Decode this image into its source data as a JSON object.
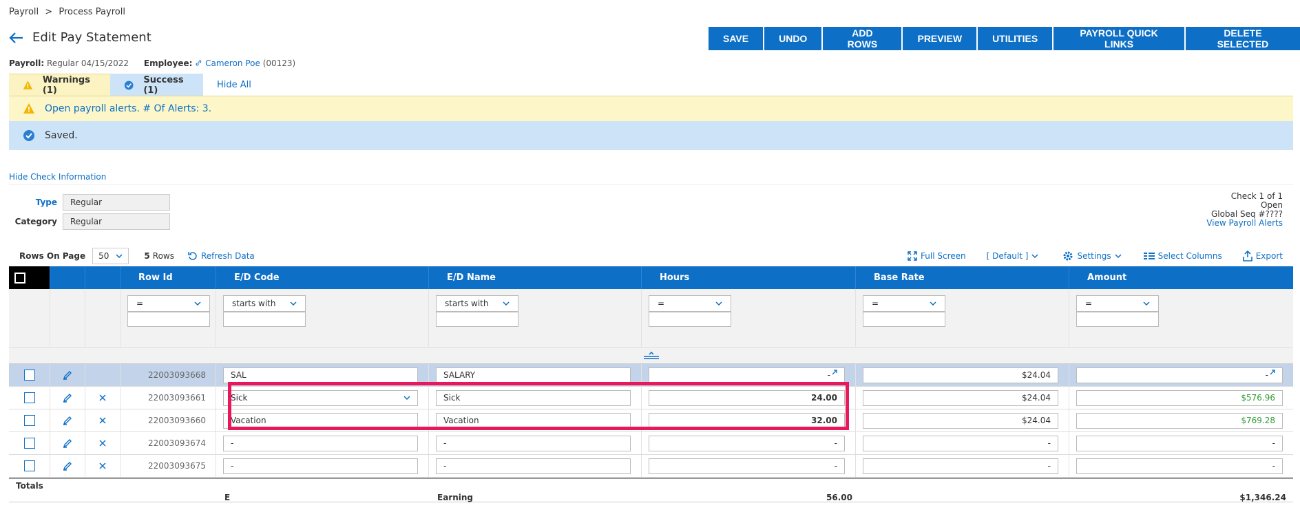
{
  "breadcrumb": {
    "root": "Payroll",
    "separator": ">",
    "current": "Process Payroll"
  },
  "page": {
    "title": "Edit Pay Statement"
  },
  "toolbar": [
    "SAVE",
    "UNDO",
    "ADD ROWS",
    "PREVIEW",
    "UTILITIES",
    "PAYROLL QUICK LINKS",
    "DELETE SELECTED"
  ],
  "meta": {
    "payroll_label": "Payroll:",
    "payroll_value": "Regular 04/15/2022",
    "employee_label": "Employee:",
    "employee_name": "Cameron Poe",
    "employee_id": "(00123)"
  },
  "tabs": {
    "warnings": "Warnings (1)",
    "success": "Success (1)",
    "hide_all": "Hide All"
  },
  "alerts": {
    "warning": "Open payroll alerts. # Of Alerts: 3.",
    "success": "Saved."
  },
  "check": {
    "hide_link": "Hide Check Information",
    "type_label": "Type",
    "type_value": "Regular",
    "category_label": "Category",
    "category_value": "Regular",
    "check_num": "Check 1 of 1",
    "status": "Open",
    "global_seq": "Global Seq #????",
    "view_alerts": "View Payroll Alerts"
  },
  "grid_tools": {
    "rows_on_page_label": "Rows On Page",
    "rows_on_page": "50",
    "row_count": "5",
    "rows_label": "Rows",
    "refresh": "Refresh Data",
    "full_screen": "Full Screen",
    "view": "[ Default ]",
    "settings": "Settings",
    "select_columns": "Select Columns",
    "export": "Export"
  },
  "columns": [
    "Row Id",
    "E/D Code",
    "E/D Name",
    "Hours",
    "Base Rate",
    "Amount"
  ],
  "filters": [
    "=",
    "starts with",
    "starts with",
    "=",
    "=",
    "="
  ],
  "rows": [
    {
      "id": "22003093668",
      "code": "SAL",
      "name": "SALARY",
      "hours": "-",
      "rate": "$24.04",
      "amount": "-"
    },
    {
      "id": "22003093661",
      "code": "Sick",
      "name": "Sick",
      "hours": "24.00",
      "rate": "$24.04",
      "amount": "$576.96"
    },
    {
      "id": "22003093660",
      "code": "Vacation",
      "name": "Vacation",
      "hours": "32.00",
      "rate": "$24.04",
      "amount": "$769.28"
    },
    {
      "id": "22003093674",
      "code": "-",
      "name": "-",
      "hours": "-",
      "rate": "-",
      "amount": "-"
    },
    {
      "id": "22003093675",
      "code": "-",
      "name": "-",
      "hours": "-",
      "rate": "-",
      "amount": "-"
    }
  ],
  "totals": {
    "label": "Totals",
    "code": "E",
    "name": "Earning",
    "hours": "56.00",
    "amount": "$1,346.24"
  },
  "colors": {
    "primary": "#0d6fc6",
    "warning_bg": "#fcf6c8",
    "success_bg": "#cde4f8",
    "highlight": "#e8185a",
    "amount_green": "#2f9a33"
  }
}
